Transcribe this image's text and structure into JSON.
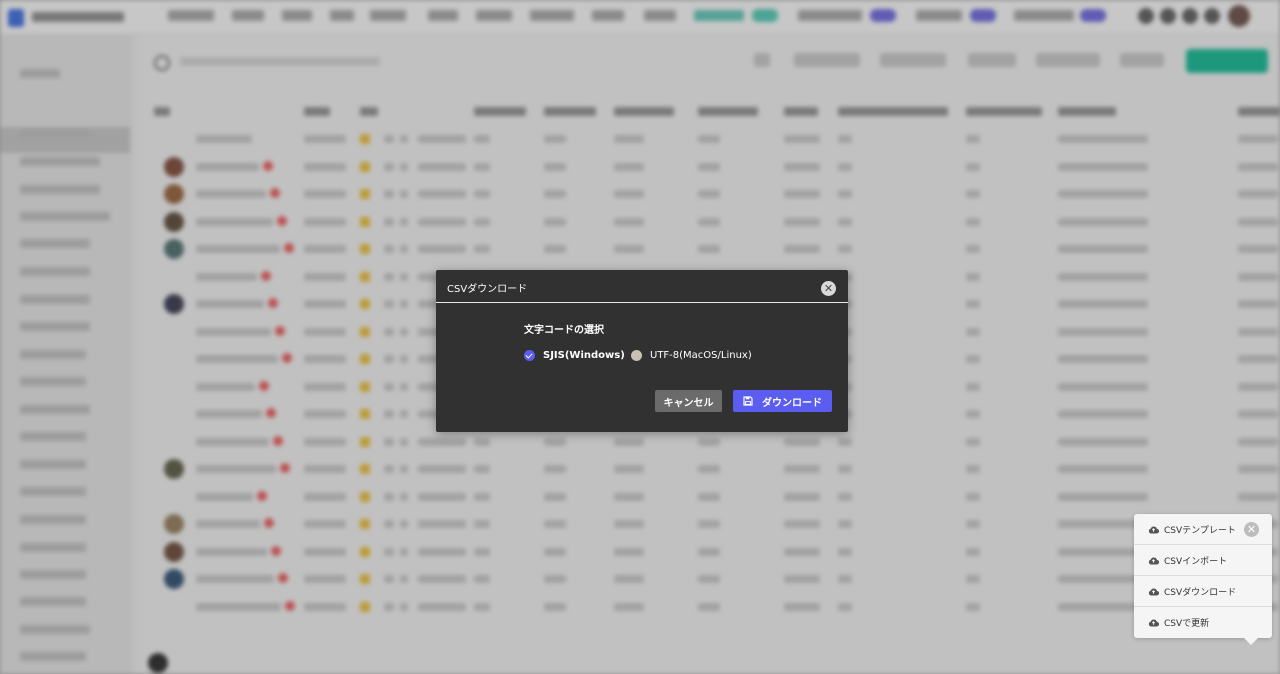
{
  "modal": {
    "title": "CSVダウンロード",
    "close_icon": "close-icon",
    "section_label": "文字コードの選択",
    "options": [
      {
        "label": "SJIS(Windows)",
        "checked": true
      },
      {
        "label": "UTF-8(MacOS/Linux)",
        "checked": false
      }
    ],
    "cancel_label": "キャンセル",
    "download_label": "ダウンロード",
    "download_icon": "save-icon"
  },
  "csv_menu": {
    "close_icon": "close-icon",
    "item_icon": "cloud-icon",
    "items": [
      {
        "label": "CSVテンプレート"
      },
      {
        "label": "CSVインポート"
      },
      {
        "label": "CSVダウンロード"
      },
      {
        "label": "CSVで更新"
      }
    ]
  },
  "colors": {
    "primary": "#5b5cf0",
    "modal_bg": "#313131",
    "cancel_bg": "#6b6b6b",
    "accent_green": "#27c3a0"
  }
}
